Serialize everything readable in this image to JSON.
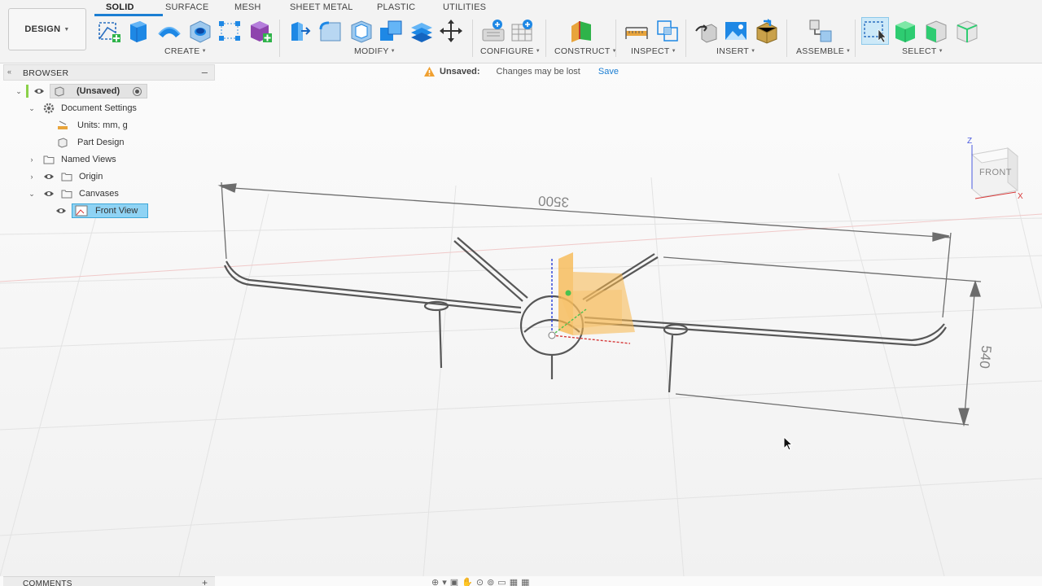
{
  "workspace": {
    "label": "DESIGN"
  },
  "tabs": [
    "SOLID",
    "SURFACE",
    "MESH",
    "SHEET METAL",
    "PLASTIC",
    "UTILITIES"
  ],
  "groups": {
    "create": "CREATE",
    "modify": "MODIFY",
    "configure": "CONFIGURE",
    "construct": "CONSTRUCT",
    "inspect": "INSPECT",
    "insert": "INSERT",
    "assemble": "ASSEMBLE",
    "select": "SELECT"
  },
  "browser": {
    "title": "BROWSER",
    "root": "(Unsaved)",
    "document_settings": "Document Settings",
    "units": "Units: mm, g",
    "part_design": "Part Design",
    "named_views": "Named Views",
    "origin": "Origin",
    "canvases": "Canvases",
    "front_view": "Front View"
  },
  "notice": {
    "label": "Unsaved:",
    "message": "Changes may be lost",
    "save": "Save"
  },
  "viewport": {
    "dim_width": "3500",
    "dim_height": "540"
  },
  "viewcube": {
    "face": "FRONT",
    "z": "Z",
    "x": "X"
  },
  "comments": {
    "title": "COMMENTS"
  },
  "colors": {
    "accent": "#1b7ed3",
    "selection": "#8fd3f4",
    "warning": "#f0a030",
    "origin_plane": "#f7b64a"
  }
}
